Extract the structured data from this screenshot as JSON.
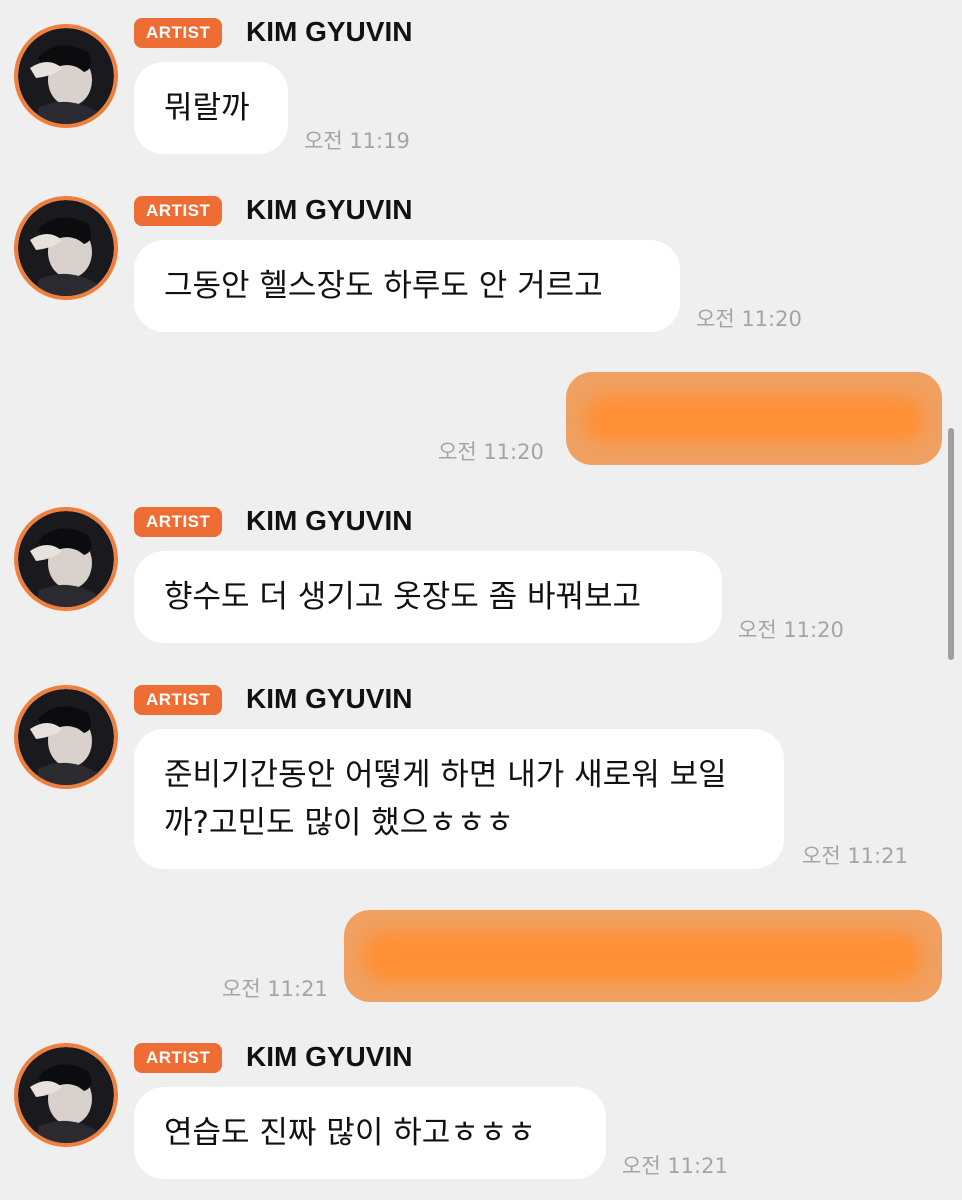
{
  "artist": {
    "badge": "ARTIST",
    "name": "KIM GYUVIN"
  },
  "colors": {
    "background": "#efeff0",
    "accent": "#ee6d35",
    "fan_bubble": "#f0a060",
    "timestamp": "#a4a4a8"
  },
  "messages": [
    {
      "sender": "artist",
      "text": "뭐랄까",
      "time": "오전 11:19"
    },
    {
      "sender": "artist",
      "text": "그동안 헬스장도 하루도 안 거르고",
      "time": "오전 11:20"
    },
    {
      "sender": "fan",
      "text": "",
      "time": "오전 11:20"
    },
    {
      "sender": "artist",
      "text": "향수도 더 생기고 옷장도 좀 바꿔보고",
      "time": "오전 11:20"
    },
    {
      "sender": "artist",
      "text": "준비기간동안 어떻게 하면 내가 새로워 보일까?고민도 많이 했으ㅎㅎㅎ",
      "time": "오전 11:21"
    },
    {
      "sender": "fan",
      "text": "",
      "time": "오전 11:21"
    },
    {
      "sender": "artist",
      "text": "연습도 진짜 많이 하고ㅎㅎㅎ",
      "time": "오전 11:21"
    }
  ]
}
